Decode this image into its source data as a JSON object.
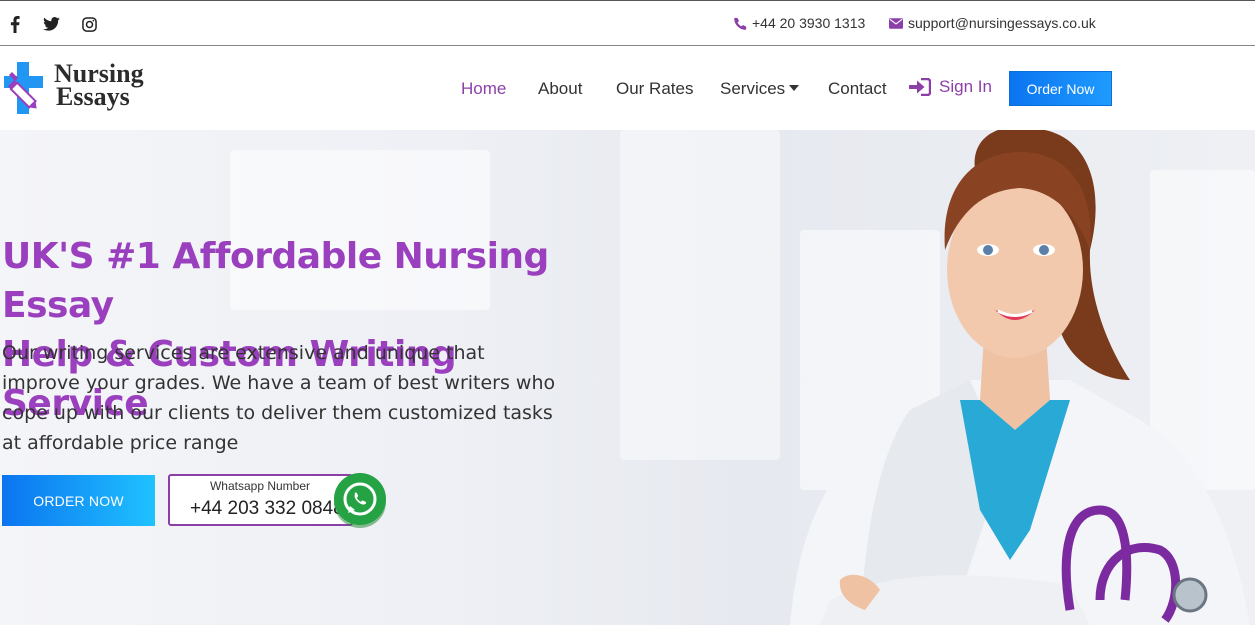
{
  "topbar": {
    "social_icons": [
      "facebook-icon",
      "twitter-icon",
      "instagram-icon"
    ],
    "phone": "+44 20 3930 1313",
    "email": "support@nursingessays.co.uk"
  },
  "brand": {
    "line1": "Nursing",
    "line2": "Essays"
  },
  "nav": {
    "items": [
      {
        "label": "Home",
        "active": true
      },
      {
        "label": "About"
      },
      {
        "label": "Our Rates"
      },
      {
        "label": "Services",
        "dropdown": true
      },
      {
        "label": "Contact"
      }
    ],
    "sign_in": "Sign In",
    "order_now": "Order Now"
  },
  "hero": {
    "title_line1": "UK'S #1 Affordable Nursing Essay",
    "title_line2": "Help & Custom Writing Service",
    "description": "Our writing services are extensive and unique that improve your grades. We have a team of best writers who cope up with our clients to deliver them customized tasks at affordable price range",
    "order_button": "ORDER NOW",
    "whatsapp_label": "Whatsapp Number",
    "whatsapp_number": "+44 203 332 0848"
  },
  "colors": {
    "brand_purple": "#9a3fbd",
    "accent_blue": "#0b74f0",
    "whatsapp_green": "#25d366"
  }
}
